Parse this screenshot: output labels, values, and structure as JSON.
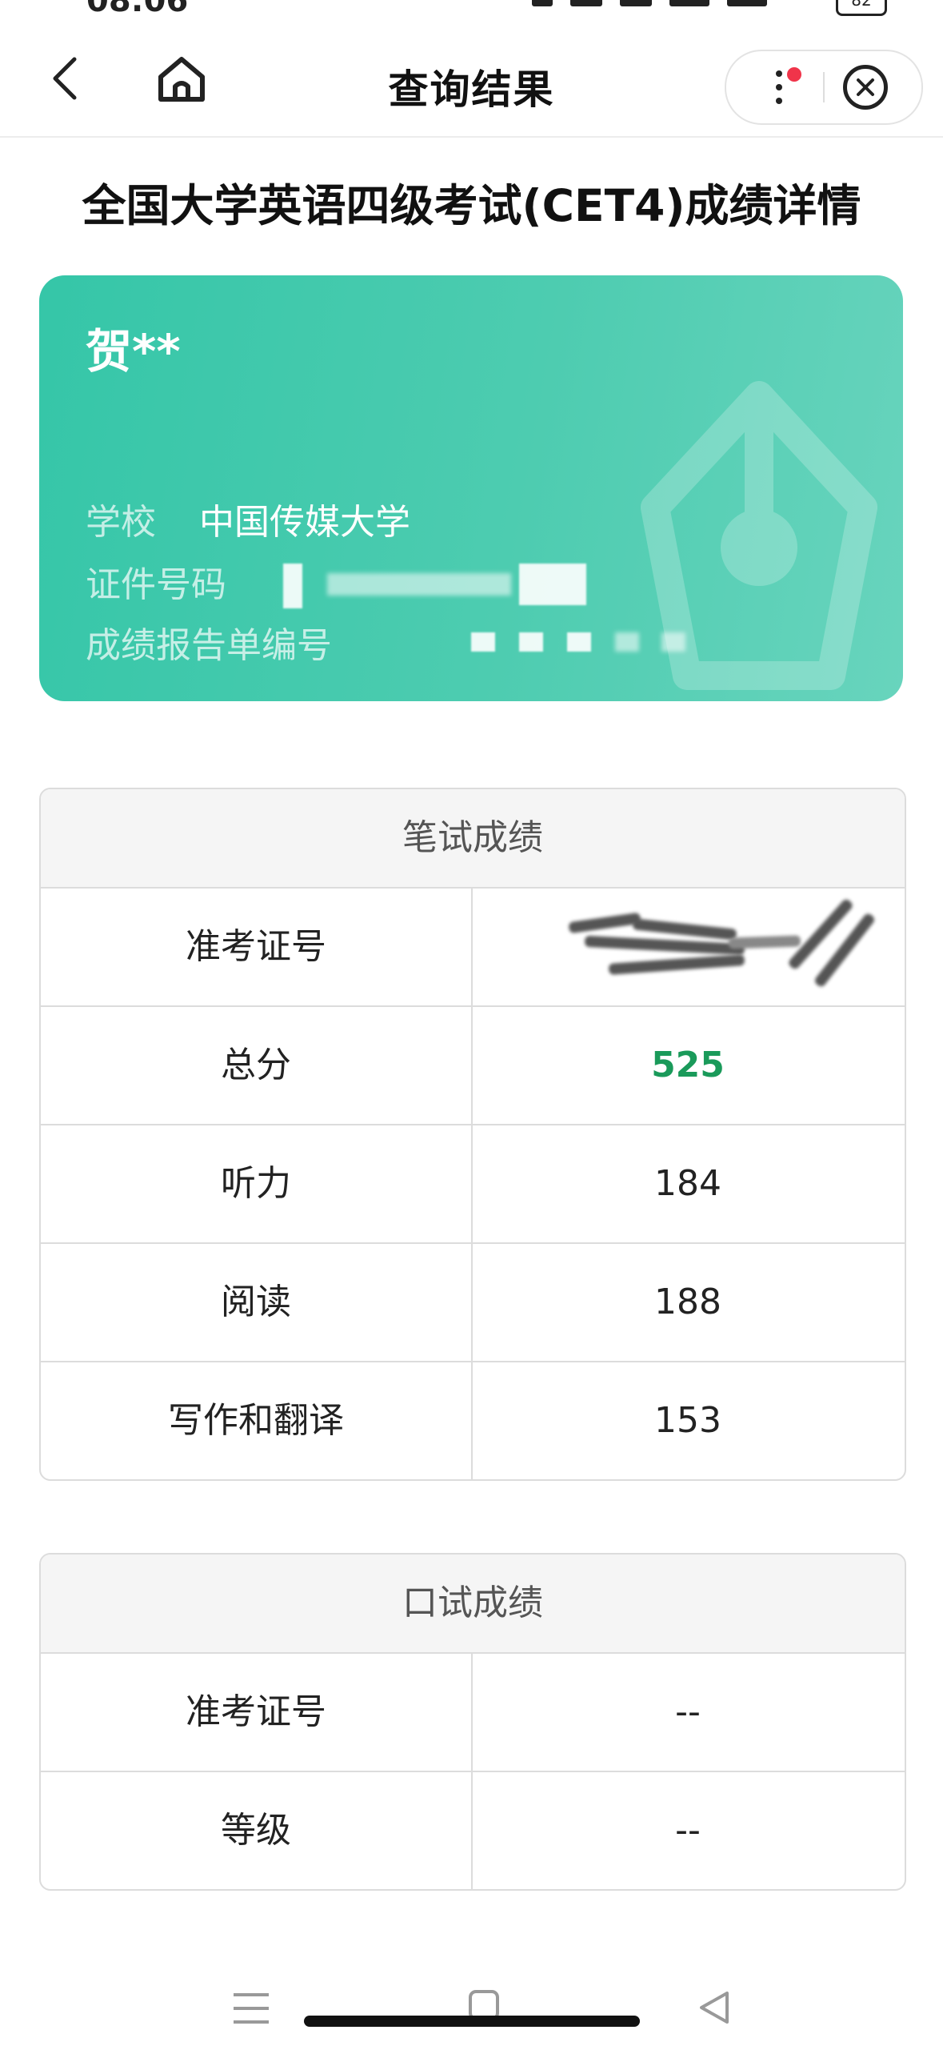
{
  "status_bar": {
    "time": "08:06",
    "battery": "82"
  },
  "nav": {
    "title": "查询结果"
  },
  "page_title": "全国大学英语四级考试(CET4)成绩详情",
  "profile": {
    "name": "贺**",
    "school_label": "学校",
    "school_value": "中国传媒大学",
    "id_label": "证件号码",
    "report_label": "成绩报告单编号"
  },
  "written": {
    "header": "笔试成绩",
    "rows": [
      {
        "label": "准考证号",
        "value": ""
      },
      {
        "label": "总分",
        "value": "525"
      },
      {
        "label": "听力",
        "value": "184"
      },
      {
        "label": "阅读",
        "value": "188"
      },
      {
        "label": "写作和翻译",
        "value": "153"
      }
    ]
  },
  "oral": {
    "header": "口试成绩",
    "rows": [
      {
        "label": "准考证号",
        "value": "--"
      },
      {
        "label": "等级",
        "value": "--"
      }
    ]
  },
  "colors": {
    "card_start": "#35c6a8",
    "card_end": "#68d4bd",
    "total_score": "#1a9a5a",
    "badge_dot": "#f0344a"
  },
  "icons": [
    "back-arrow-icon",
    "home-icon",
    "more-icon",
    "close-circle-icon",
    "watermark-pen-icon",
    "menu-icon",
    "square-home-icon",
    "triangle-back-icon"
  ]
}
